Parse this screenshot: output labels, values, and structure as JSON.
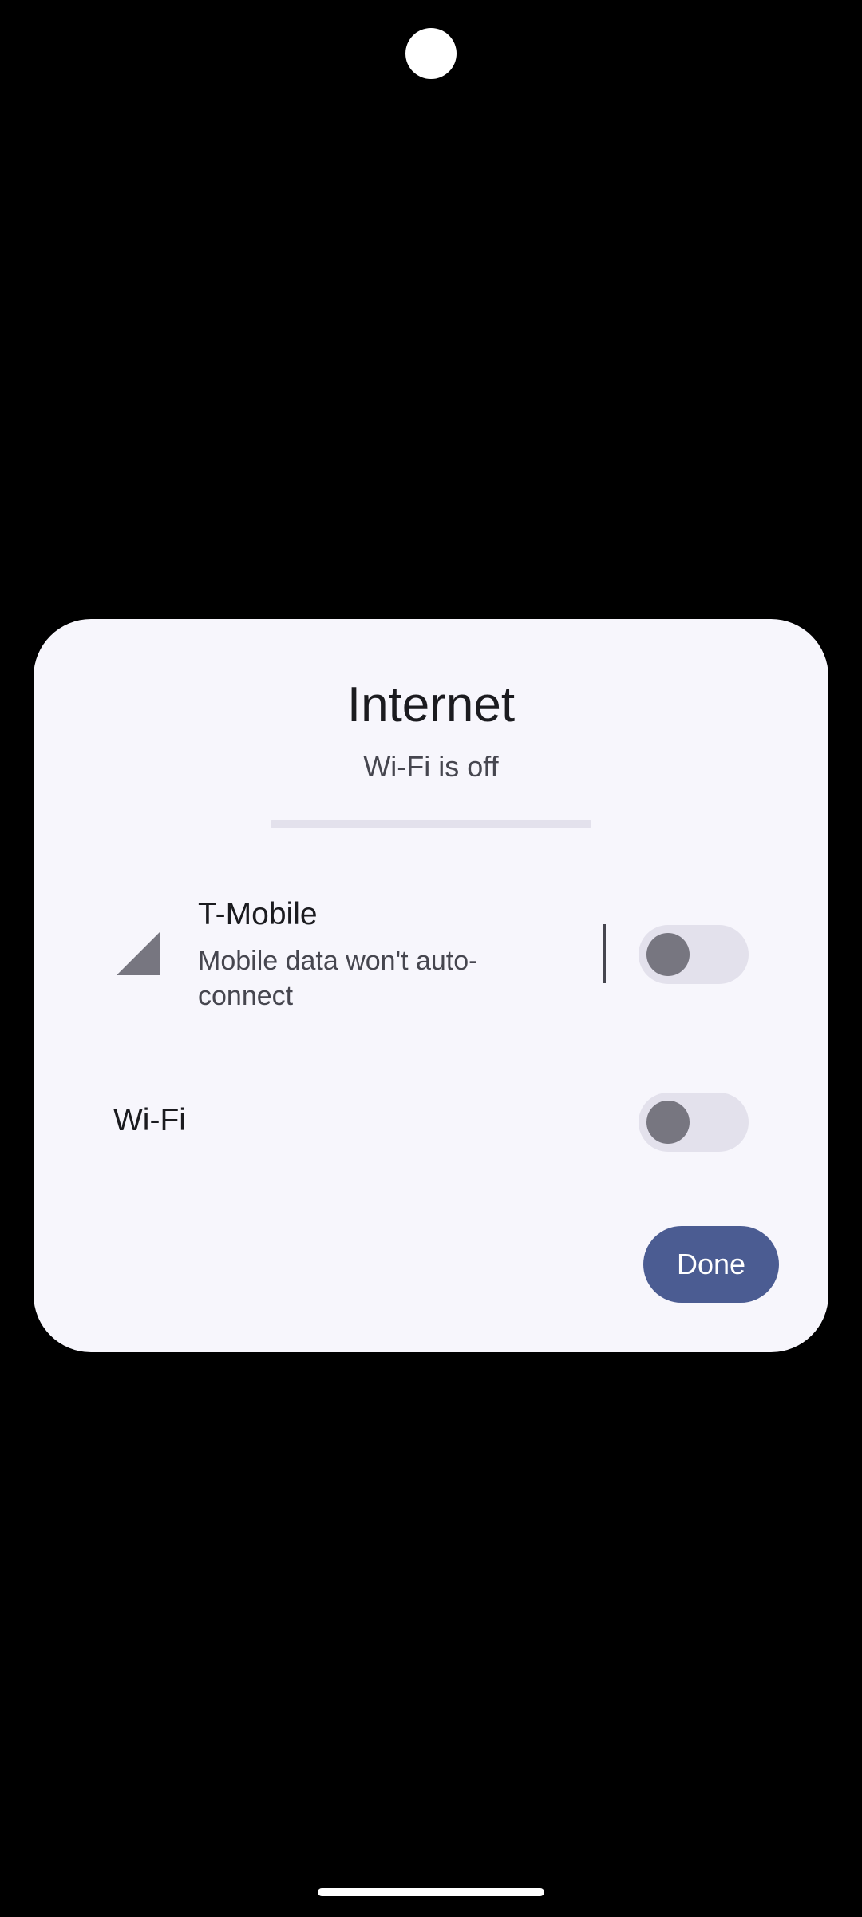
{
  "dialog": {
    "title": "Internet",
    "subtitle": "Wi-Fi is off"
  },
  "mobile": {
    "icon": "cell-signal-icon",
    "name": "T-Mobile",
    "summary": "Mobile data won't auto-connect",
    "toggle_on": false
  },
  "wifi": {
    "label": "Wi-Fi",
    "toggle_on": false
  },
  "actions": {
    "done_label": "Done"
  },
  "colors": {
    "dialog_background": "#f7f6fc",
    "accent": "#4b5c92",
    "toggle_track": "#e3e1ec",
    "toggle_thumb": "#777680"
  }
}
